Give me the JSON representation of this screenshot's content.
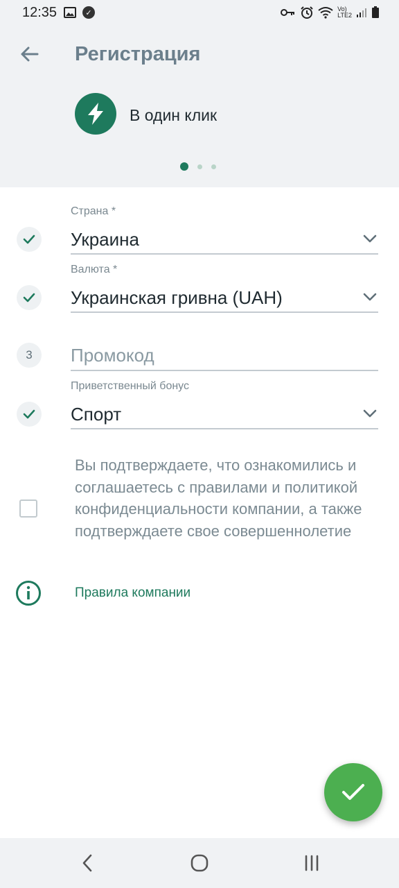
{
  "status_bar": {
    "time": "12:35",
    "left_icons": [
      "image-icon",
      "notification-badge-icon"
    ],
    "right_icons": [
      "vpn-key-icon",
      "alarm-icon",
      "wifi-icon",
      "volte-lte-icon",
      "signal-icon",
      "battery-icon"
    ],
    "network_text_top": "Vo)",
    "network_text_bottom": "LTE2"
  },
  "header": {
    "title": "Регистрация",
    "back_icon": "arrow-left-icon"
  },
  "registration_type": {
    "label": "В один клик",
    "icon": "lightning-icon",
    "icon_bg": "#1e7a5d"
  },
  "pager": {
    "count": 3,
    "active_index": 0
  },
  "form": {
    "country": {
      "label": "Страна *",
      "value": "Украина",
      "status": "check"
    },
    "currency": {
      "label": "Валюта *",
      "value": "Украинская гривна (UAH)",
      "status": "check"
    },
    "promo": {
      "step": "3",
      "placeholder": "Промокод"
    },
    "bonus": {
      "label": "Приветственный бонус",
      "value": "Спорт",
      "status": "check"
    }
  },
  "consent": {
    "text": "Вы подтверждаете, что ознакомились и соглашаетесь с правилами и политикой конфиденциальности компании, а также подтверждаете свое совершеннолетие",
    "checked": false
  },
  "rules": {
    "link_text": "Правила компании"
  },
  "fab": {
    "icon": "checkmark-icon",
    "color": "#4caf50"
  },
  "colors": {
    "accent": "#1e7a5d",
    "header_bg": "#f0f2f4",
    "muted_text": "#7b8a92"
  }
}
